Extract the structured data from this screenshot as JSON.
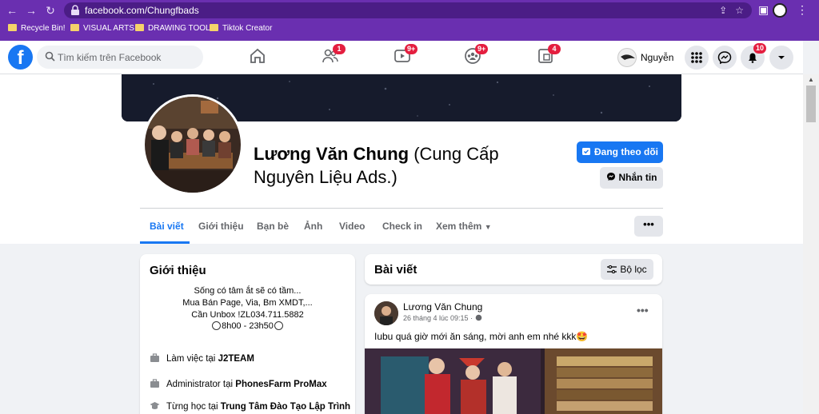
{
  "browser": {
    "url": "facebook.com/Chungfbads",
    "bookmarks": [
      "Recycle Bin!",
      "VISUAL ARTS",
      "DRAWING TOOL",
      "Tiktok Creator"
    ]
  },
  "header": {
    "search_placeholder": "Tìm kiếm trên Facebook",
    "badges": {
      "friends": "1",
      "watch": "9+",
      "groups": "9+",
      "gaming": "4",
      "notifications": "10"
    },
    "me_name": "Nguyễn"
  },
  "profile": {
    "name": "Lương Văn Chung",
    "name_suffix": " (Cung Cấp Nguyên Liệu Ads.)",
    "follow_label": "Đang theo dõi",
    "message_label": "Nhắn tin",
    "more_label": "•••",
    "tabs": [
      "Bài viết",
      "Giới thiệu",
      "Bạn bè",
      "Ảnh",
      "Video",
      "Check in",
      "Xem thêm"
    ]
  },
  "intro": {
    "title": "Giới thiệu",
    "bio": [
      "Sống có tâm ắt sẽ có tầm...",
      "Mua Bán Page, Via, Bm XMDT,...",
      "Cần Unbox !ZL034.711.5882"
    ],
    "hours": "8h00 - 23h50",
    "rows": [
      {
        "prefix": "Làm việc tại ",
        "strong": "J2TEAM"
      },
      {
        "prefix": "Administrator tại ",
        "strong": "PhonesFarm ProMax"
      },
      {
        "prefix": "Từng học tại ",
        "strong": "Trung Tâm Đào Tạo Lập Trình"
      }
    ]
  },
  "posts": {
    "title": "Bài viết",
    "filter_label": "Bộ lọc",
    "items": [
      {
        "author": "Lương Văn Chung",
        "time": "26 tháng 4 lúc 09:15",
        "text": "Iubu quá giờ mới ăn sáng, mời anh em nhé kkk🤩"
      }
    ]
  },
  "colors": {
    "browser": "#6a2fb0",
    "fb_blue": "#1877f2",
    "badge": "#e41e3f"
  },
  "icons": [
    "back-icon",
    "forward-icon",
    "reload-icon",
    "lock-icon",
    "share-icon",
    "star-icon",
    "sidebar-icon",
    "menu-dots-icon",
    "folder-icon",
    "facebook-logo-icon",
    "search-icon",
    "home-icon",
    "friends-icon",
    "watch-icon",
    "groups-icon",
    "gaming-icon",
    "apps-grid-icon",
    "messenger-icon",
    "bell-icon",
    "caret-down-icon",
    "follow-icon",
    "messenger-icon",
    "filter-icon",
    "globe-icon",
    "briefcase-icon",
    "graduation-cap-icon",
    "clock-icon"
  ]
}
